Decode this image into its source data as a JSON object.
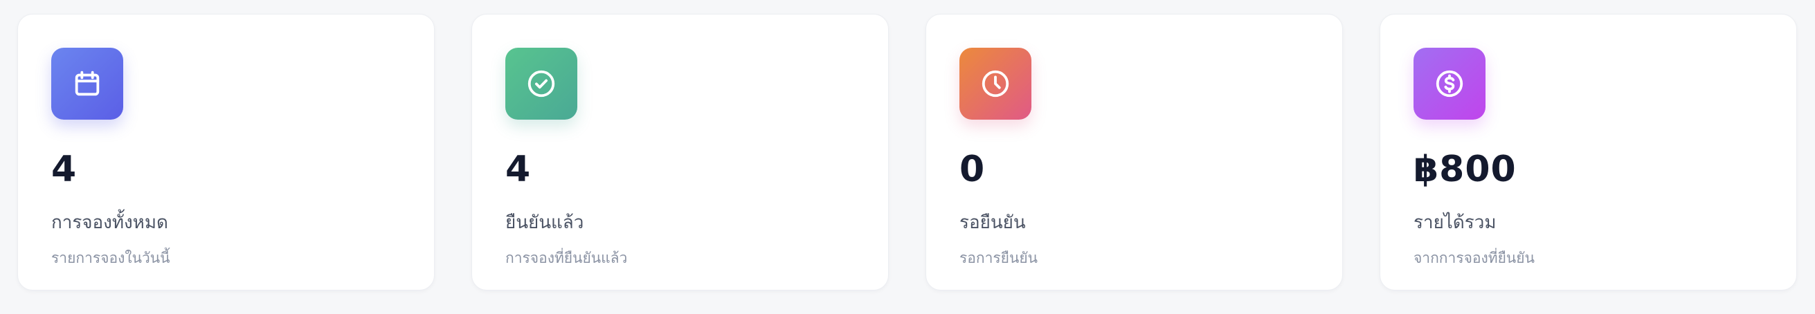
{
  "cards": [
    {
      "icon": "calendar-icon",
      "value": "4",
      "label": "การจองทั้งหมด",
      "subtitle": "รายการจองในวันนี้",
      "color_from": "#6b85ef",
      "color_to": "#5b5fe6"
    },
    {
      "icon": "check-circle-icon",
      "value": "4",
      "label": "ยืนยันแล้ว",
      "subtitle": "การจองที่ยืนยันแล้ว",
      "color_from": "#58c48f",
      "color_to": "#4aa995"
    },
    {
      "icon": "clock-icon",
      "value": "0",
      "label": "รอยืนยัน",
      "subtitle": "รอการยืนยัน",
      "color_from": "#ec8a3c",
      "color_to": "#e05a86"
    },
    {
      "icon": "dollar-icon",
      "value": "฿800",
      "label": "รายได้รวม",
      "subtitle": "จากการจองที่ยืนยัน",
      "color_from": "#a26ef2",
      "color_to": "#c045ec"
    }
  ]
}
